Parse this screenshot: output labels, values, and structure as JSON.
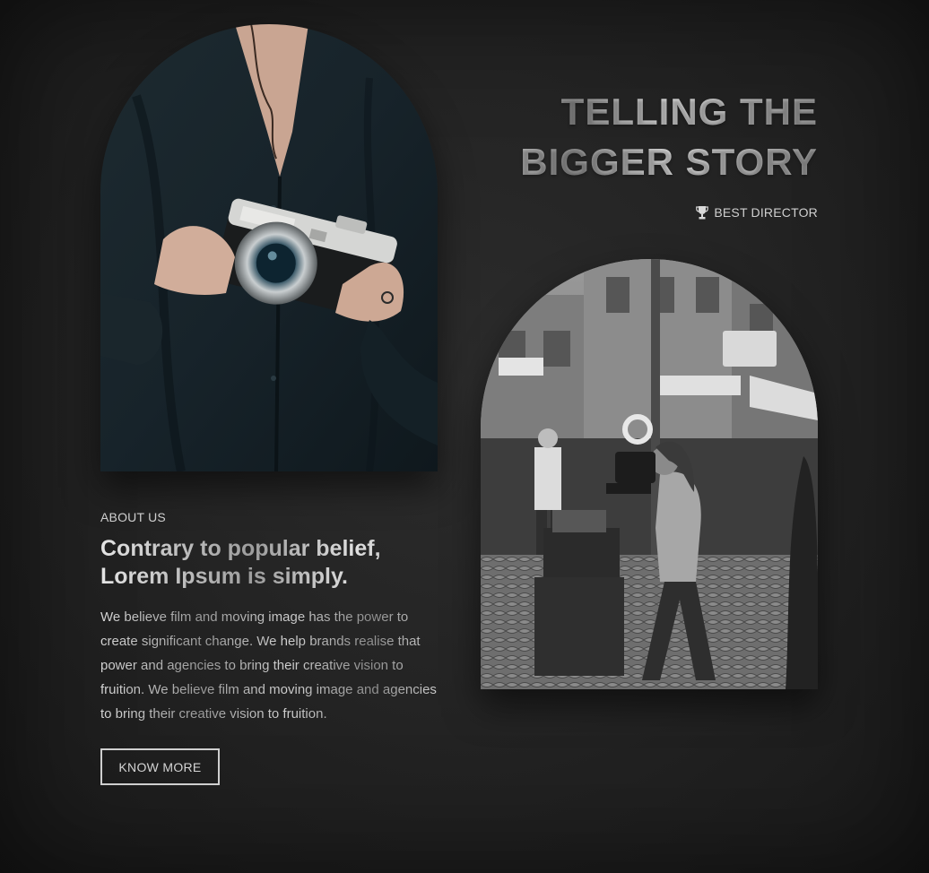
{
  "hero": {
    "title_line1": "TELLING THE",
    "title_line2": "BIGGER STORY",
    "award_label": "BEST DIRECTOR",
    "award_icon": "trophy-icon"
  },
  "images": {
    "left_alt": "Person holding a vintage camera",
    "right_alt": "Photographer with large format camera on a city street"
  },
  "about": {
    "label": "ABOUT US",
    "heading_line1": "Contrary to popular belief,",
    "heading_line2": "Lorem Ipsum is simply.",
    "body": "We believe film and moving image has the power to create significant change. We help brands realise that power and agencies to bring their creative vision to fruition. We believe film and moving image and agencies to bring their creative vision to fruition.",
    "button_label": "KNOW MORE"
  },
  "colors": {
    "background": "#242424",
    "text": "#d8d8d8",
    "button_border": "#cfcfcf"
  }
}
